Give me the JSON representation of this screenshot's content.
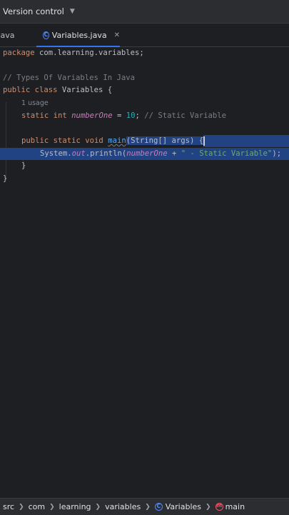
{
  "toolbar": {
    "vcs_label": "Version control"
  },
  "tabs": [
    {
      "label": ".java"
    },
    {
      "label": "Variables.java",
      "active": true
    }
  ],
  "editor": {
    "l1": {
      "kw": "package",
      "rest": " com.learning.variables;"
    },
    "l3": {
      "comment": "// Types Of Variables In Java"
    },
    "l4": {
      "kw": "public class",
      "rest": " Variables {"
    },
    "hint": "1 usage",
    "l5": {
      "kw": "static int",
      "field": "numberOne",
      "eq": " = ",
      "num": "10",
      "semi": "; ",
      "comment": "// Static Variable"
    },
    "l7": {
      "kw": "public static void",
      "fn": "main",
      "rest": "(String[] args) {"
    },
    "l8": {
      "sys": "System.",
      "out": "out",
      "println": ".println(",
      "field": "numberOne",
      "plus": " + ",
      "str": "\" - Static Variable\"",
      "end": ");"
    },
    "l9": {
      "text": "}"
    },
    "l10": {
      "text": "}"
    }
  },
  "breadcrumb": {
    "items": [
      "src",
      "com",
      "learning",
      "variables",
      "Variables",
      "main"
    ]
  },
  "colors": {
    "accent": "#3574f0",
    "selection": "#214283",
    "background": "#1e1f22"
  }
}
